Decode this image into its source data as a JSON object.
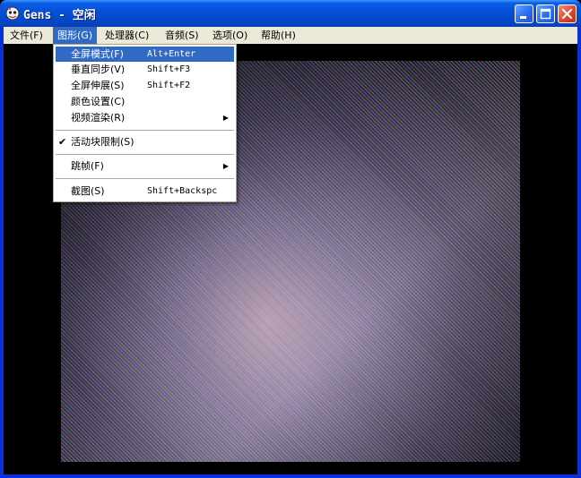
{
  "window": {
    "title": "Gens - 空闲",
    "accent": "#0a5de6"
  },
  "menubar": {
    "items": [
      {
        "label": "文件(F)"
      },
      {
        "label": "图形(G)"
      },
      {
        "label": "处理器(C)"
      },
      {
        "label": "音频(S)"
      },
      {
        "label": "选项(O)"
      },
      {
        "label": "帮助(H)"
      }
    ],
    "active_index": 1
  },
  "graphics_menu": {
    "fullscreen": {
      "label": "全屏模式(F)",
      "shortcut": "Alt+Enter"
    },
    "vsync": {
      "label": "垂直同步(V)",
      "shortcut": "Shift+F3"
    },
    "stretch": {
      "label": "全屏伸展(S)",
      "shortcut": "Shift+F2"
    },
    "color_settings": {
      "label": "颜色设置(C)"
    },
    "video_render": {
      "label": "视频渲染(R)"
    },
    "sprite_limit": {
      "label": "活动块限制(S)",
      "checked": true
    },
    "frame_skip": {
      "label": "跳帧(F)"
    },
    "screenshot": {
      "label": "截图(S)",
      "shortcut": "Shift+Backspc"
    }
  }
}
